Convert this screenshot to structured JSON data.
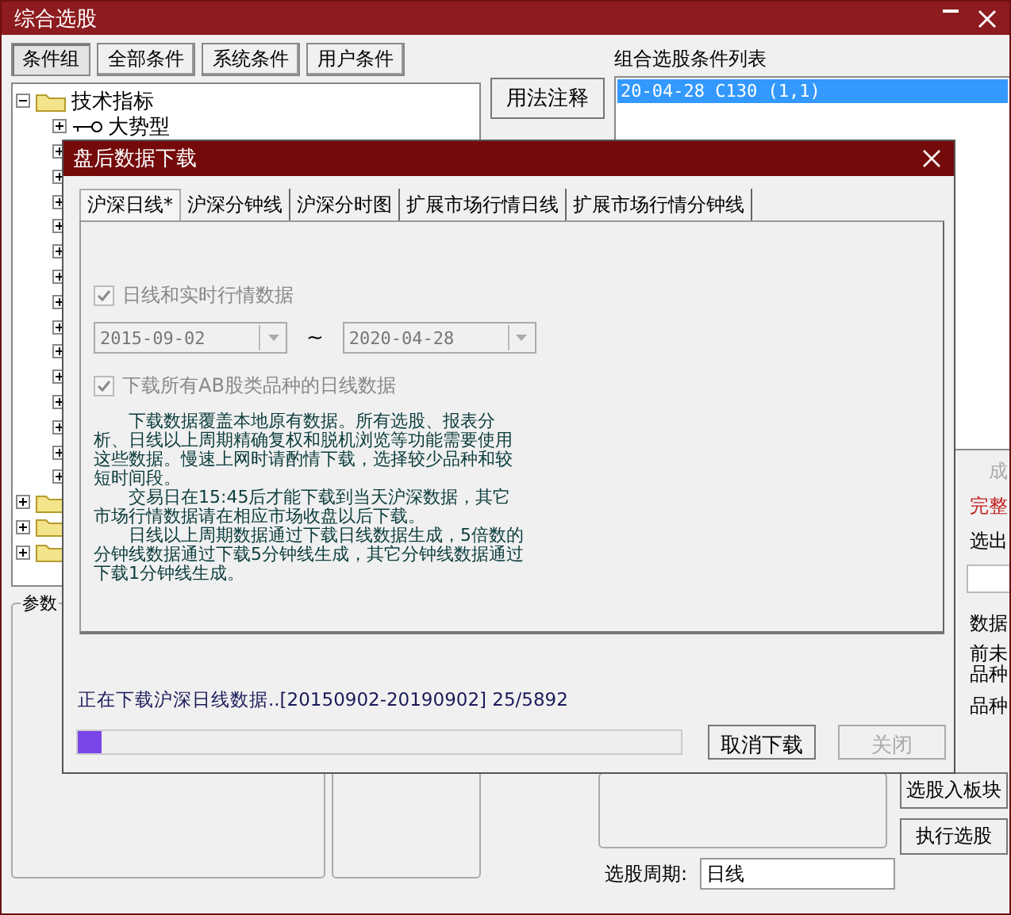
{
  "window": {
    "title": "综合选股"
  },
  "condition_tabs": [
    {
      "label": "条件组",
      "selected": true
    },
    {
      "label": "全部条件",
      "selected": false
    },
    {
      "label": "系统条件",
      "selected": false
    },
    {
      "label": "用户条件",
      "selected": false
    }
  ],
  "tree": [
    {
      "label": "技术指标",
      "kind": "folder",
      "expanded": true,
      "children": [
        {
          "label": "大势型",
          "kind": "formula",
          "expanded": false
        },
        {
          "kind": "hidden",
          "expanded": false
        },
        {
          "kind": "hidden",
          "expanded": false
        },
        {
          "kind": "hidden",
          "expanded": false
        },
        {
          "kind": "hidden",
          "expanded": false
        },
        {
          "kind": "hidden",
          "expanded": false
        },
        {
          "kind": "hidden",
          "expanded": false
        },
        {
          "kind": "hidden",
          "expanded": false
        },
        {
          "kind": "hidden",
          "expanded": false
        },
        {
          "kind": "hidden",
          "expanded": false
        },
        {
          "kind": "hidden",
          "expanded": false
        },
        {
          "kind": "hidden",
          "expanded": false
        },
        {
          "kind": "hidden",
          "expanded": false
        },
        {
          "kind": "hidden",
          "expanded": false
        },
        {
          "kind": "hidden",
          "expanded": false
        }
      ]
    },
    {
      "kind": "folder",
      "expanded": false
    },
    {
      "kind": "folder",
      "expanded": false
    },
    {
      "kind": "folder",
      "expanded": false
    }
  ],
  "params_group": {
    "label": "参数"
  },
  "usage_button": {
    "label": "用法注释"
  },
  "condition_list": {
    "title": "组合选股条件列表",
    "items": [
      {
        "text": "20-04-28 C130 (1,1)",
        "selected": true
      }
    ]
  },
  "right_fragments": [
    {
      "kind": "muted",
      "text": "成"
    },
    {
      "kind": "warning",
      "text": "完整"
    },
    {
      "kind": "plain",
      "text": "选出"
    },
    {
      "kind": "field"
    },
    {
      "kind": "plain",
      "text": "数据"
    },
    {
      "kind": "tight",
      "text": "前未"
    },
    {
      "kind": "plain",
      "text": "品种"
    },
    {
      "kind": "plain",
      "text": "品种"
    }
  ],
  "action_buttons": [
    {
      "label": "选股入板块"
    },
    {
      "label": "执行选股"
    }
  ],
  "period": {
    "label": "选股周期:",
    "value": "日线"
  },
  "dialog": {
    "title": "盘后数据下载",
    "tabs": [
      {
        "label": "沪深日线*",
        "selected": true
      },
      {
        "label": "沪深分钟线",
        "selected": false
      },
      {
        "label": "沪深分时图",
        "selected": false
      },
      {
        "label": "扩展市场行情日线",
        "selected": false
      },
      {
        "label": "扩展市场行情分钟线",
        "selected": false
      }
    ],
    "realtime_checkbox": {
      "label": "日线和实时行情数据",
      "checked": true,
      "disabled": true
    },
    "date_range": {
      "start": "2015-09-02",
      "separator": "~",
      "end": "2020-04-28"
    },
    "ab_checkbox": {
      "label": "下载所有AB股类品种的日线数据",
      "checked": true,
      "disabled": true
    },
    "notes": [
      "下载数据覆盖本地原有数据。所有选股、报表分析、日线以上周期精确复权和脱机浏览等功能需要使用这些数据。慢速上网时请酌情下载，选择较少品种和较短时间段。",
      "交易日在15:45后才能下载到当天沪深数据，其它市场行情数据请在相应市场收盘以后下载。",
      "日线以上周期数据通过下载日线数据生成，5倍数的分钟线数据通过下载5分钟线生成，其它分钟线数据通过下载1分钟线生成。"
    ],
    "status": "正在下载沪深日线数据..[20150902-20190902] 25/5892",
    "progress": {
      "level": 0.04
    },
    "buttons": [
      {
        "label": "取消下载",
        "disabled": false
      },
      {
        "label": "关闭",
        "disabled": true
      }
    ]
  }
}
